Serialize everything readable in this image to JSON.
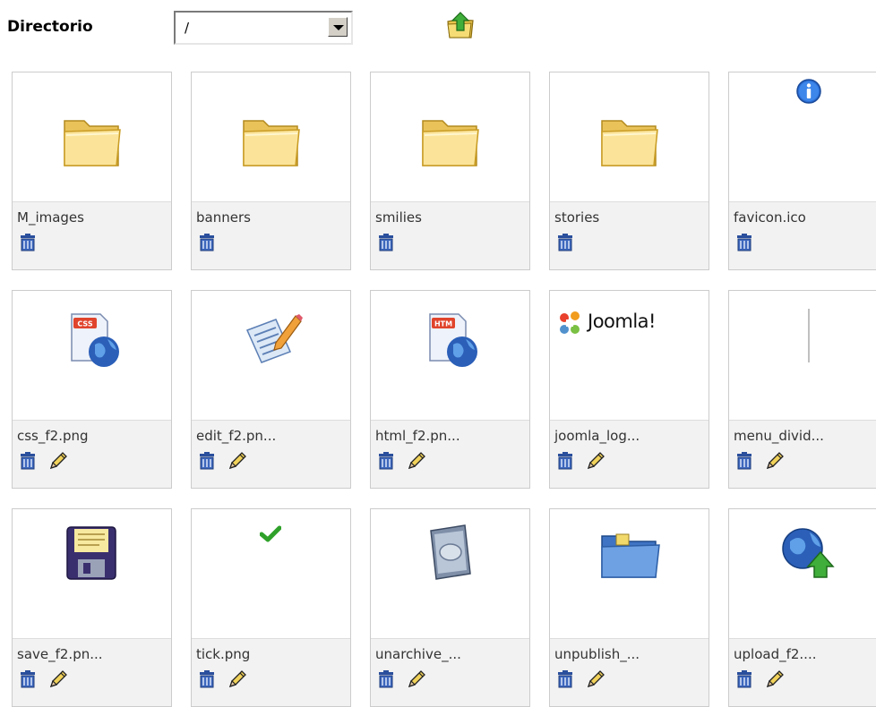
{
  "toolbar": {
    "directory_label": "Directorio",
    "directory_value": "/",
    "up_icon": "folder-up-icon"
  },
  "items": [
    {
      "name": "M_images",
      "icon": "folder-icon",
      "actions": [
        "delete-icon"
      ]
    },
    {
      "name": "banners",
      "icon": "folder-icon",
      "actions": [
        "delete-icon"
      ]
    },
    {
      "name": "smilies",
      "icon": "folder-icon",
      "actions": [
        "delete-icon"
      ]
    },
    {
      "name": "stories",
      "icon": "folder-icon",
      "actions": [
        "delete-icon"
      ]
    },
    {
      "name": "favicon.ico",
      "icon": "info-icon",
      "actions": [
        "delete-icon"
      ]
    },
    {
      "name": "css_f2.png",
      "icon": "css-file-icon",
      "actions": [
        "delete-icon",
        "edit-icon"
      ]
    },
    {
      "name": "edit_f2.pn...",
      "icon": "edit-document-icon",
      "actions": [
        "delete-icon",
        "edit-icon"
      ]
    },
    {
      "name": "html_f2.pn...",
      "icon": "html-file-icon",
      "actions": [
        "delete-icon",
        "edit-icon"
      ]
    },
    {
      "name": "joomla_log...",
      "icon": "joomla-logo",
      "logo_text": "Joomla!",
      "actions": [
        "delete-icon",
        "edit-icon"
      ]
    },
    {
      "name": "menu_divid...",
      "icon": "divider-line-icon",
      "actions": [
        "delete-icon",
        "edit-icon"
      ]
    },
    {
      "name": "save_f2.pn...",
      "icon": "floppy-disk-icon",
      "actions": [
        "delete-icon",
        "edit-icon"
      ]
    },
    {
      "name": "tick.png",
      "icon": "check-mark-icon",
      "actions": [
        "delete-icon",
        "edit-icon"
      ]
    },
    {
      "name": "unarchive_...",
      "icon": "unarchive-icon",
      "actions": [
        "delete-icon",
        "edit-icon"
      ]
    },
    {
      "name": "unpublish_...",
      "icon": "blue-folder-icon",
      "actions": [
        "delete-icon",
        "edit-icon"
      ]
    },
    {
      "name": "upload_f2....",
      "icon": "globe-upload-icon",
      "actions": [
        "delete-icon",
        "edit-icon"
      ]
    }
  ]
}
